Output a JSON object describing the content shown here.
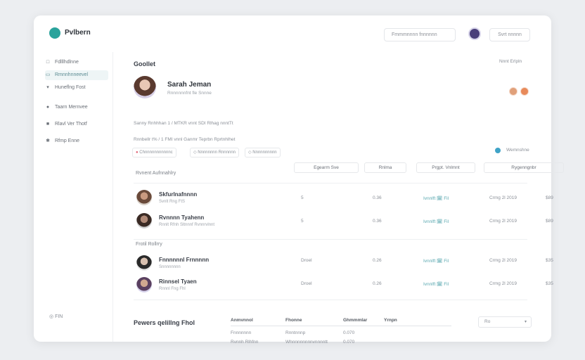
{
  "app": {
    "name": "Pvlbern"
  },
  "topbar": {
    "search_label": "Fmmmnnnn fnnnnnn",
    "account_label": "Svrt nnnnn"
  },
  "sidebar": {
    "items": [
      {
        "label": "Fdlllhdlnne",
        "icon": "list-icon"
      },
      {
        "label": "Rmnnhnneevel",
        "icon": "home-icon"
      },
      {
        "label": "Huneflng Fost",
        "icon": "filter-icon"
      },
      {
        "label": "Taarn Mernvee",
        "icon": "user-icon"
      },
      {
        "label": "Rlavl Ver Thotf",
        "icon": "flag-icon"
      },
      {
        "label": "Rfmp Enne",
        "icon": "gear-icon"
      }
    ],
    "footer_label": "FIN"
  },
  "main": {
    "section_title": "Goollet",
    "top_right_label": "Nnnt Erlpln",
    "profile": {
      "name": "Sarah Jeman",
      "subtitle": "Rnnnnnnfnt fle Snnne"
    },
    "meta_line1": "Sanny Rnhhhan 1 / MTKR vnnt    SDI Rlhag nnntTt",
    "meta_line2": "Rnnbellr  t% / 1 FMI vnnl  Ganmr  Teprbn  Rprtnhlhet",
    "chips": [
      "Chnnnnnnnnnnnc",
      "Nnnnnnnn Rnnnnnn",
      "Nnnnnnnnnn"
    ],
    "legend_label": "Wemnshne",
    "columns": [
      "Egearm Sve",
      "Rnlma",
      "Prgpt. Vnlmnt",
      "Rygenngnbr"
    ]
  },
  "groups": [
    {
      "title": "Rvnent Aufnnahlry",
      "rows": [
        {
          "name": "Skfurlnafnnnn",
          "sub": "Svnlt Rng FtS",
          "c1": "5",
          "c2": "0.36",
          "link": "Ivnnlft 🗓 Fil",
          "date": "Crmg 2l 2019",
          "amt": "$89"
        },
        {
          "name": "Rvnnnn Tyahenn",
          "sub": "Rnnlt Rfnh Sltnnnf Rvnnrvlnnt",
          "c1": "5",
          "c2": "0.36",
          "link": "Ivnnlft 🗓 Fil",
          "date": "Crmg 2l 2019",
          "amt": "$89"
        }
      ]
    },
    {
      "title": "Frotil Rollrry",
      "rows": [
        {
          "name": "Fnnnnnnl Frnnnnn",
          "sub": "Snnnnnnnn",
          "c1": "Droel",
          "c2": "0.26",
          "link": "Ivnnlft 🗓 Fil",
          "date": "Crmg 2l 2019",
          "amt": "$35"
        },
        {
          "name": "Rinnsel Tyaen",
          "sub": "Rnnnl Fng Fhl",
          "c1": "Droel",
          "c2": "0.26",
          "link": "Ivnnlft 🗓 Fil",
          "date": "Crmg 2l 2019",
          "amt": "$35"
        }
      ]
    }
  ],
  "bottom": {
    "title": "Pewers qelillng Fhol",
    "headers": [
      "Anmvnnol",
      "Fhonne",
      "Ghmmmlar",
      "Yrnpn"
    ],
    "rows": [
      [
        "Fnnnnnnn",
        "Rnntnnnp",
        "0.070"
      ],
      [
        "Rvnnh Rlhfnn",
        "Whnnnnnnnnvnnnntt",
        "0.070"
      ]
    ],
    "select_value": "Ro"
  },
  "colors": {
    "accent": "#2aa39c",
    "link": "#5aa8b0",
    "legend": "#3fa3c7"
  }
}
